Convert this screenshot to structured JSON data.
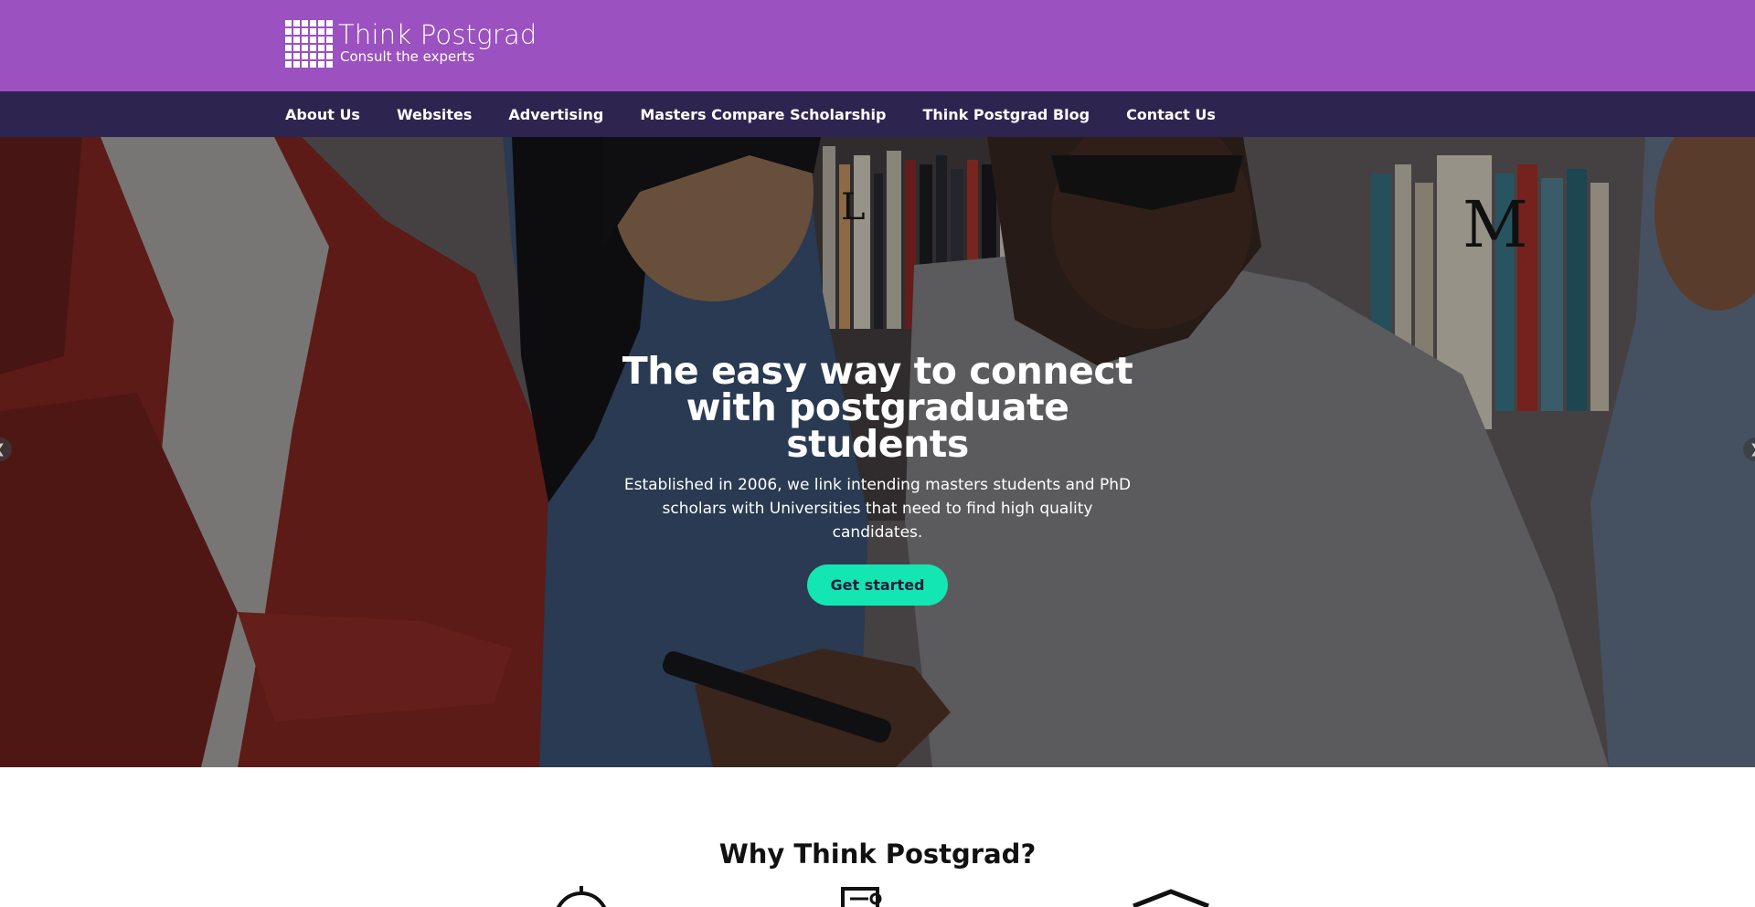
{
  "brand": {
    "name": "Think Postgrad",
    "tagline": "Consult the experts",
    "colors": {
      "header": "#9b51bf",
      "nav": "#2e2450",
      "cta": "#14e6b3"
    }
  },
  "nav": {
    "items": [
      {
        "label": "About Us"
      },
      {
        "label": "Websites"
      },
      {
        "label": "Advertising"
      },
      {
        "label": "Masters Compare Scholarship"
      },
      {
        "label": "Think Postgrad Blog"
      },
      {
        "label": "Contact Us"
      }
    ]
  },
  "hero": {
    "title": "The easy way to connect with postgraduate students",
    "subtitle": "Established in 2006, we link intending masters students and PhD scholars with Universities that need to find high quality candidates.",
    "cta_label": "Get started",
    "arrow_left": "chevron-left-icon",
    "arrow_right": "chevron-right-icon"
  },
  "why": {
    "title": "Why Think Postgrad?",
    "icons": [
      "stopwatch-icon",
      "document-icon",
      "graduation-cap-icon"
    ]
  }
}
